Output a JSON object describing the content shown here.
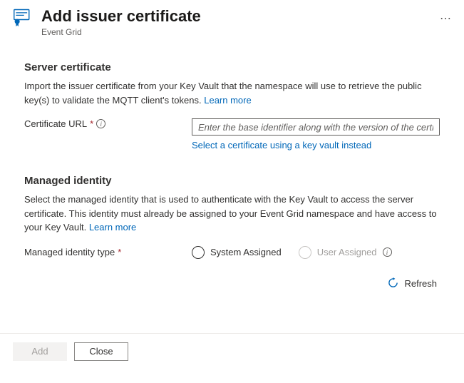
{
  "header": {
    "title": "Add issuer certificate",
    "subtitle": "Event Grid"
  },
  "serverCert": {
    "heading": "Server certificate",
    "desc_pre": "Import the issuer certificate from your Key Vault that the namespace will use to retrieve the public key(s) to validate the MQTT client's tokens. ",
    "learn_more": "Learn more",
    "url_label": "Certificate URL",
    "url_placeholder": "Enter the base identifier along with the version of the certificate",
    "kv_link": "Select a certificate using a key vault instead"
  },
  "managedIdentity": {
    "heading": "Managed identity",
    "desc_pre": "Select the managed identity that is used to authenticate with the Key Vault to access the server certificate. This identity must already be assigned to your Event Grid namespace and have access to your Key Vault. ",
    "learn_more": "Learn more",
    "type_label": "Managed identity type",
    "options": {
      "system": "System Assigned",
      "user": "User Assigned"
    },
    "refresh": "Refresh"
  },
  "footer": {
    "add": "Add",
    "close": "Close"
  }
}
